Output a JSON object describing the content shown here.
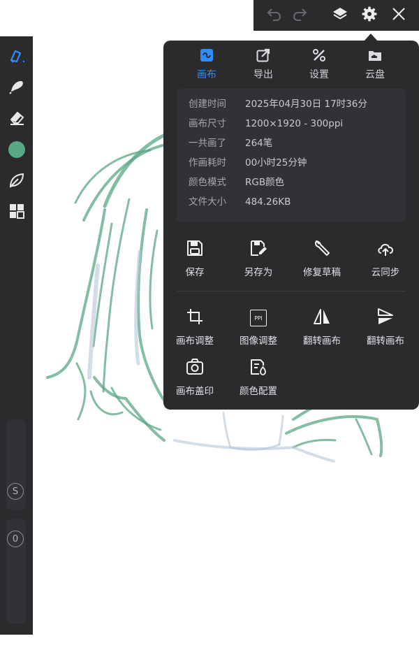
{
  "toolbar": {
    "undo_icon": "undo-icon",
    "redo_icon": "redo-icon",
    "layers_icon": "layers-icon",
    "settings_icon": "gear-icon",
    "close_icon": "close-icon"
  },
  "left_tools": {
    "brush_icon": "pen-brush-icon",
    "smudge_icon": "smudge-icon",
    "eraser_icon": "eraser-icon",
    "color_swatch": "#5aa783",
    "leaf_icon": "leaf-icon",
    "grid_icon": "grid-icon",
    "size_badge": "S",
    "opacity_badge": "0"
  },
  "popup": {
    "tabs": [
      {
        "label": "画布",
        "icon": "canvas-icon",
        "active": true
      },
      {
        "label": "导出",
        "icon": "export-icon",
        "active": false
      },
      {
        "label": "设置",
        "icon": "tools-icon",
        "active": false
      },
      {
        "label": "云盘",
        "icon": "cloud-folder-icon",
        "active": false
      }
    ],
    "info": [
      {
        "key": "创建时间",
        "value": "2025年04月30日 17时36分"
      },
      {
        "key": "画布尺寸",
        "value": "1200×1920 - 300ppi"
      },
      {
        "key": "一共画了",
        "value": "264笔"
      },
      {
        "key": "作画耗时",
        "value": "00小时25分钟"
      },
      {
        "key": "颜色模式",
        "value": "RGB颜色"
      },
      {
        "key": "文件大小",
        "value": "484.26KB"
      }
    ],
    "file_actions": [
      {
        "label": "保存",
        "icon": "save-icon"
      },
      {
        "label": "另存为",
        "icon": "save-as-icon"
      },
      {
        "label": "修复草稿",
        "icon": "wrench-icon"
      },
      {
        "label": "云同步",
        "icon": "cloud-sync-icon"
      }
    ],
    "canvas_actions": [
      {
        "label": "画布调整",
        "icon": "crop-icon"
      },
      {
        "label": "图像调整",
        "icon": "ppi-icon",
        "icon_text": "PPI"
      },
      {
        "label": "翻转画布",
        "icon": "flip-horizontal-icon"
      },
      {
        "label": "翻转画布",
        "icon": "flip-vertical-icon"
      },
      {
        "label": "画布盖印",
        "icon": "camera-stamp-icon"
      },
      {
        "label": "颜色配置",
        "icon": "color-profile-icon"
      }
    ]
  },
  "colors": {
    "panel_bg": "#2b2b2e",
    "accent": "#2f8cff",
    "sketch_green": "#5aa783"
  }
}
